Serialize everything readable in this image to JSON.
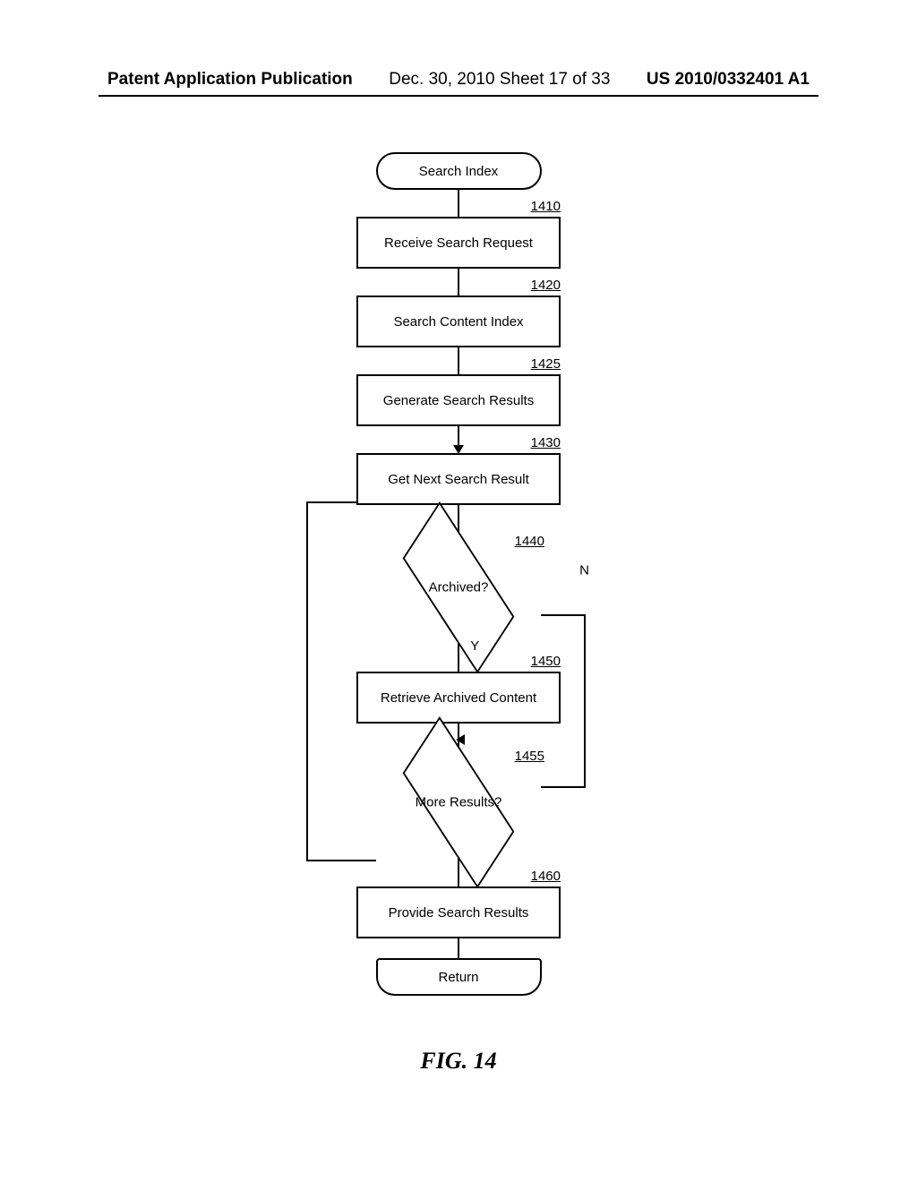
{
  "header": {
    "left": "Patent Application Publication",
    "mid": "Dec. 30, 2010  Sheet 17 of 33",
    "right": "US 2010/0332401 A1"
  },
  "flow": {
    "start": "Search Index",
    "steps": [
      {
        "ref": "1410",
        "label": "Receive Search Request"
      },
      {
        "ref": "1420",
        "label": "Search Content Index"
      },
      {
        "ref": "1425",
        "label": "Generate Search Results"
      },
      {
        "ref": "1430",
        "label": "Get Next Search Result"
      }
    ],
    "decision1": {
      "ref": "1440",
      "label": "Archived?",
      "yes": "Y",
      "no": "N"
    },
    "step_after_yes": {
      "ref": "1450",
      "label": "Retrieve Archived Content"
    },
    "decision2": {
      "ref": "1455",
      "label": "More Results?"
    },
    "step_final": {
      "ref": "1460",
      "label": "Provide Search Results"
    },
    "end": "Return"
  },
  "figure_caption": "FIG. 14"
}
